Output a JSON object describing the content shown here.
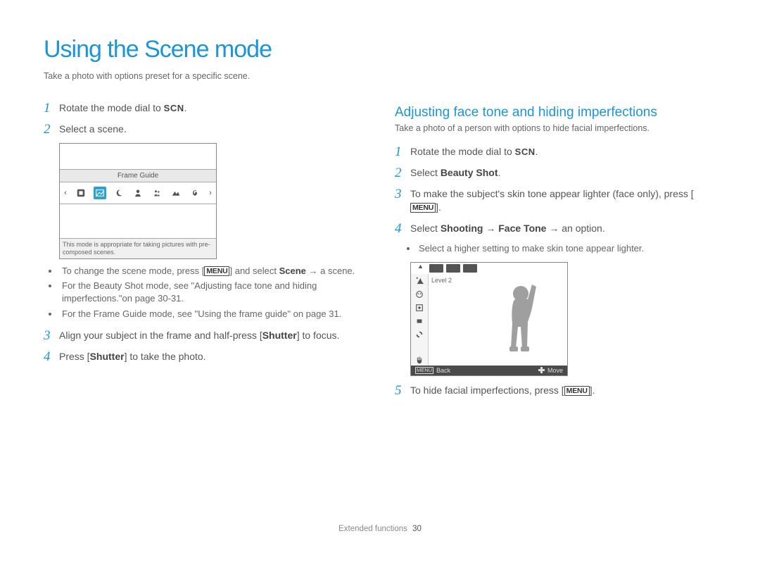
{
  "title": "Using the Scene mode",
  "subtitle": "Take a photo with options preset for a specific scene.",
  "scn_label": "SCN",
  "menu_label": "MENU",
  "left": {
    "steps": {
      "1": {
        "num": "1",
        "text_pre": "Rotate the mode dial to ",
        "text_post": "."
      },
      "2": {
        "num": "2",
        "text": "Select a scene."
      },
      "3": {
        "num": "3",
        "text_pre": "Align your subject in the frame and half-press [",
        "shutter": "Shutter",
        "text_post": "] to focus."
      },
      "4": {
        "num": "4",
        "text_pre": "Press [",
        "shutter": "Shutter",
        "text_post": "] to take the photo."
      }
    },
    "lcd": {
      "label": "Frame Guide",
      "caption": "This mode is appropriate for taking pictures with pre-composed scenes."
    },
    "bullets": {
      "b1_pre": "To change the scene mode, press [",
      "b1_mid": "] and select ",
      "b1_scene": "Scene",
      "b1_post": " → a scene.",
      "b2": "For the Beauty Shot mode, see \"Adjusting face tone and hiding imperfections.\"on page 30-31.",
      "b3": "For the Frame Guide mode, see \"Using the frame guide\" on page 31."
    }
  },
  "right": {
    "heading": "Adjusting face tone and hiding imperfections",
    "sub": "Take a photo of a person with options to hide facial imperfections.",
    "steps": {
      "1": {
        "num": "1",
        "text_pre": "Rotate the mode dial to ",
        "text_post": "."
      },
      "2": {
        "num": "2",
        "text_pre": "Select ",
        "bs": "Beauty Shot",
        "text_post": "."
      },
      "3": {
        "num": "3",
        "text_pre": "To make the subject's skin tone appear lighter (face only), press [",
        "text_post": "]."
      },
      "4": {
        "num": "4",
        "text_pre": "Select ",
        "shooting": "Shooting",
        "arrow": " → ",
        "facetone": "Face Tone",
        "text_post": " → an option."
      },
      "5": {
        "num": "5",
        "text_pre": "To hide facial imperfections, press [",
        "text_post": "]."
      }
    },
    "sub_bullet": "Select a higher setting to make skin tone appear lighter.",
    "lcd": {
      "level": "Level 2",
      "back": "Back",
      "move": "Move"
    }
  },
  "footer": {
    "section": "Extended functions",
    "page": "30"
  }
}
